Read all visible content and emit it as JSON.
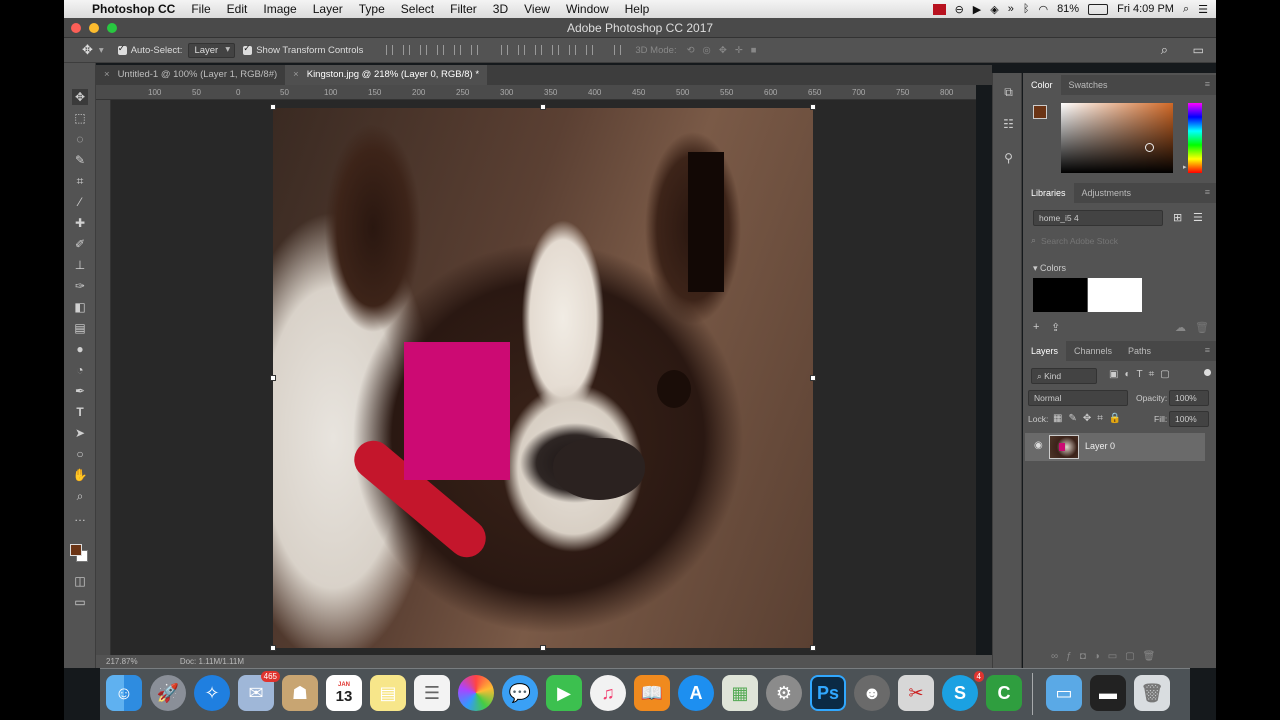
{
  "menubar": {
    "app": "Photoshop CC",
    "items": [
      "File",
      "Edit",
      "Image",
      "Layer",
      "Type",
      "Select",
      "Filter",
      "3D",
      "View",
      "Window",
      "Help"
    ],
    "battery": "81%",
    "clock": "Fri 4:09 PM"
  },
  "window": {
    "title": "Adobe Photoshop CC 2017"
  },
  "options": {
    "auto_select": "Auto-Select:",
    "auto_select_target": "Layer",
    "show_transform": "Show Transform Controls",
    "mode_3d": "3D Mode:"
  },
  "tabs": [
    {
      "label": "Untitled-1 @ 100% (Layer 1, RGB/8#)",
      "active": false
    },
    {
      "label": "Kingston.jpg @ 218% (Layer 0, RGB/8) *",
      "active": true
    }
  ],
  "ruler_top": [
    "100",
    "50",
    "0",
    "50",
    "100",
    "150",
    "200",
    "250",
    "300",
    "350",
    "400",
    "450",
    "500",
    "550",
    "600",
    "650",
    "700",
    "750",
    "800"
  ],
  "status": {
    "zoom": "217.87%",
    "doc": "Doc: 1.11M/1.11M"
  },
  "panels": {
    "color": {
      "tabs": [
        "Color",
        "Swatches"
      ],
      "fg": "#6b3415",
      "bg": "#ffffff",
      "pink": "#cc0a73"
    },
    "libraries": {
      "tabs": [
        "Libraries",
        "Adjustments"
      ],
      "library": "home_i5 4",
      "search_placeholder": "Search Adobe Stock",
      "section": "Colors",
      "swatch_colors": [
        "#000000",
        "#ffffff"
      ]
    },
    "layers": {
      "tabs": [
        "Layers",
        "Channels",
        "Paths"
      ],
      "kind": "Kind",
      "blend": "Normal",
      "opacity_label": "Opacity:",
      "opacity": "100%",
      "lock_label": "Lock:",
      "fill_label": "Fill:",
      "fill": "100%",
      "layer_name": "Layer 0"
    }
  },
  "dock": {
    "mail_badge": "465",
    "calendar_day": "13",
    "calendar_month": "JAN",
    "skype_badge": "4",
    "ps_label": "Ps"
  }
}
